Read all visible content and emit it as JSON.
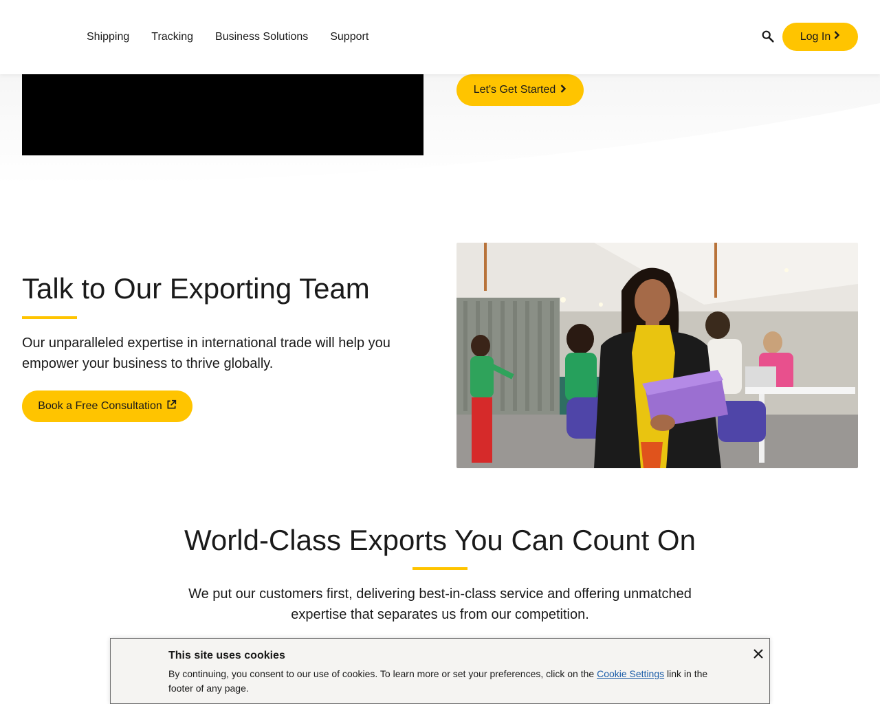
{
  "header": {
    "nav": [
      "Shipping",
      "Tracking",
      "Business Solutions",
      "Support"
    ],
    "login_label": "Log In"
  },
  "hero": {
    "cta_label": "Let's Get Started"
  },
  "talk": {
    "title": "Talk to Our Exporting Team",
    "body": "Our unparalleled expertise in international trade will help you empower your business to thrive globally.",
    "cta_label": "Book a Free Consultation"
  },
  "world": {
    "title": "World-Class Exports You Can Count On",
    "body": "We put our customers first, delivering best-in-class service and offering unmatched expertise that separates us from our competition."
  },
  "cookie": {
    "title": "This site uses cookies",
    "text_before": "By continuing, you consent to our use of cookies. To learn more or set your preferences, click on the ",
    "link": "Cookie Settings",
    "text_after": " link in the footer of any page."
  },
  "colors": {
    "accent": "#ffc400",
    "link": "#1a5ca8"
  },
  "icons": {
    "search": "search-icon",
    "chevron": "chevron-right-icon",
    "external": "external-link-icon",
    "close": "close-icon"
  }
}
